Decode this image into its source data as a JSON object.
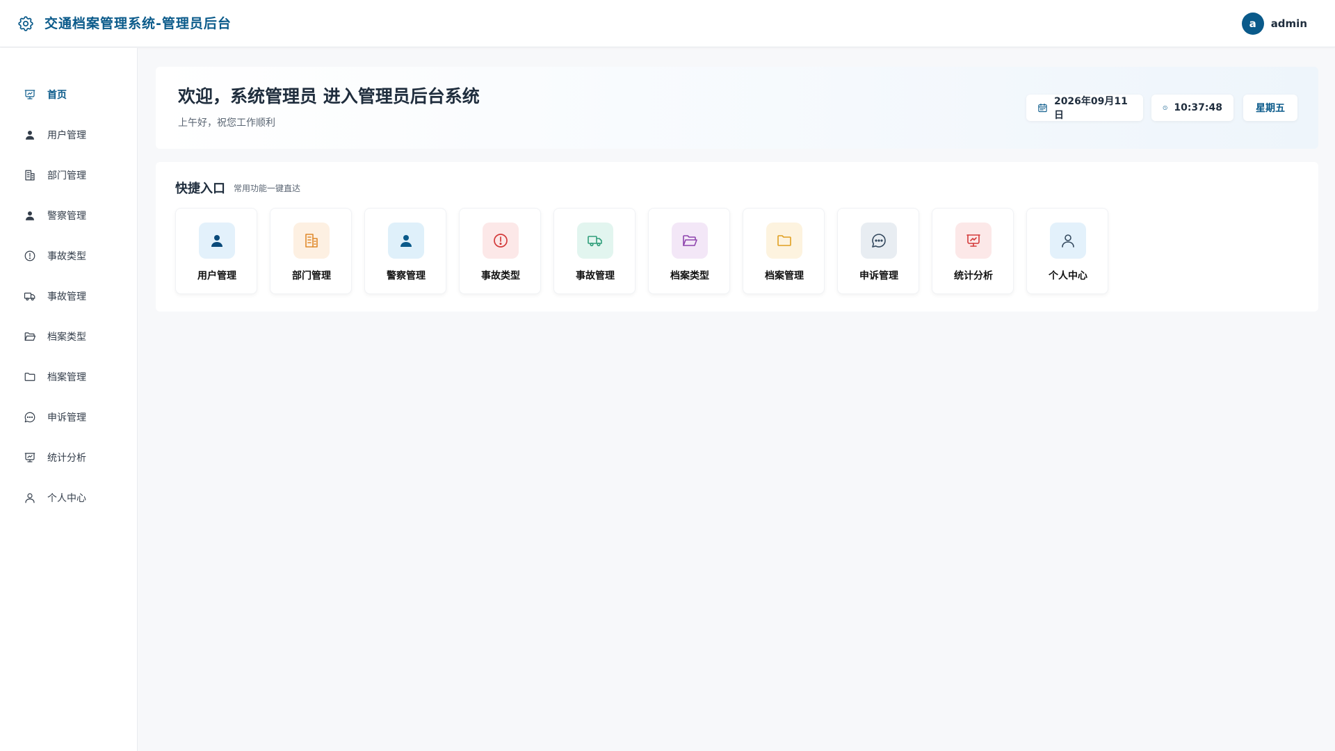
{
  "app": {
    "title": "交通档案管理系统-管理员后台"
  },
  "user": {
    "avatar_letter": "a",
    "name": "admin"
  },
  "sidebar": {
    "items": [
      {
        "label": "首页",
        "icon": "presentation-chart-icon",
        "active": true
      },
      {
        "label": "用户管理",
        "icon": "user-icon"
      },
      {
        "label": "部门管理",
        "icon": "building-icon"
      },
      {
        "label": "警察管理",
        "icon": "user-icon"
      },
      {
        "label": "事故类型",
        "icon": "alert-circle-icon"
      },
      {
        "label": "事故管理",
        "icon": "truck-icon"
      },
      {
        "label": "档案类型",
        "icon": "folder-open-icon"
      },
      {
        "label": "档案管理",
        "icon": "folder-icon"
      },
      {
        "label": "申诉管理",
        "icon": "message-circle-icon"
      },
      {
        "label": "统计分析",
        "icon": "presentation-chart-icon"
      },
      {
        "label": "个人中心",
        "icon": "user-outline-icon"
      }
    ]
  },
  "welcome": {
    "title": "欢迎，系统管理员 进入管理员后台系统",
    "subtitle": "上午好，祝您工作顺利",
    "date": "2026年09月11日",
    "time": "10:37:48",
    "weekday": "星期五"
  },
  "quick": {
    "title": "快捷入口",
    "subtitle": "常用功能一键直达",
    "tiles": [
      {
        "label": "用户管理",
        "icon": "user-icon",
        "bg": "#e3f1fb",
        "fg": "#0a4a7a"
      },
      {
        "label": "部门管理",
        "icon": "building-icon",
        "bg": "#fdf0e2",
        "fg": "#e08a2c"
      },
      {
        "label": "警察管理",
        "icon": "user-icon",
        "bg": "#dff0fa",
        "fg": "#0a5a8a"
      },
      {
        "label": "事故类型",
        "icon": "alert-circle-icon",
        "bg": "#fce8e8",
        "fg": "#d33a3a"
      },
      {
        "label": "事故管理",
        "icon": "truck-icon",
        "bg": "#e2f5ef",
        "fg": "#2f9e7a"
      },
      {
        "label": "档案类型",
        "icon": "folder-open-icon",
        "bg": "#f3e7f7",
        "fg": "#8e44ad"
      },
      {
        "label": "档案管理",
        "icon": "folder-icon",
        "bg": "#fdf3df",
        "fg": "#e0a020"
      },
      {
        "label": "申诉管理",
        "icon": "message-circle-icon",
        "bg": "#e8edf2",
        "fg": "#34495e"
      },
      {
        "label": "统计分析",
        "icon": "presentation-chart-icon",
        "bg": "#fce8e8",
        "fg": "#d33a3a"
      },
      {
        "label": "个人中心",
        "icon": "user-outline-icon",
        "bg": "#e3f1fb",
        "fg": "#34495e"
      }
    ]
  },
  "colors": {
    "accent": "#0a5a8a",
    "background": "#f7f8fa"
  }
}
